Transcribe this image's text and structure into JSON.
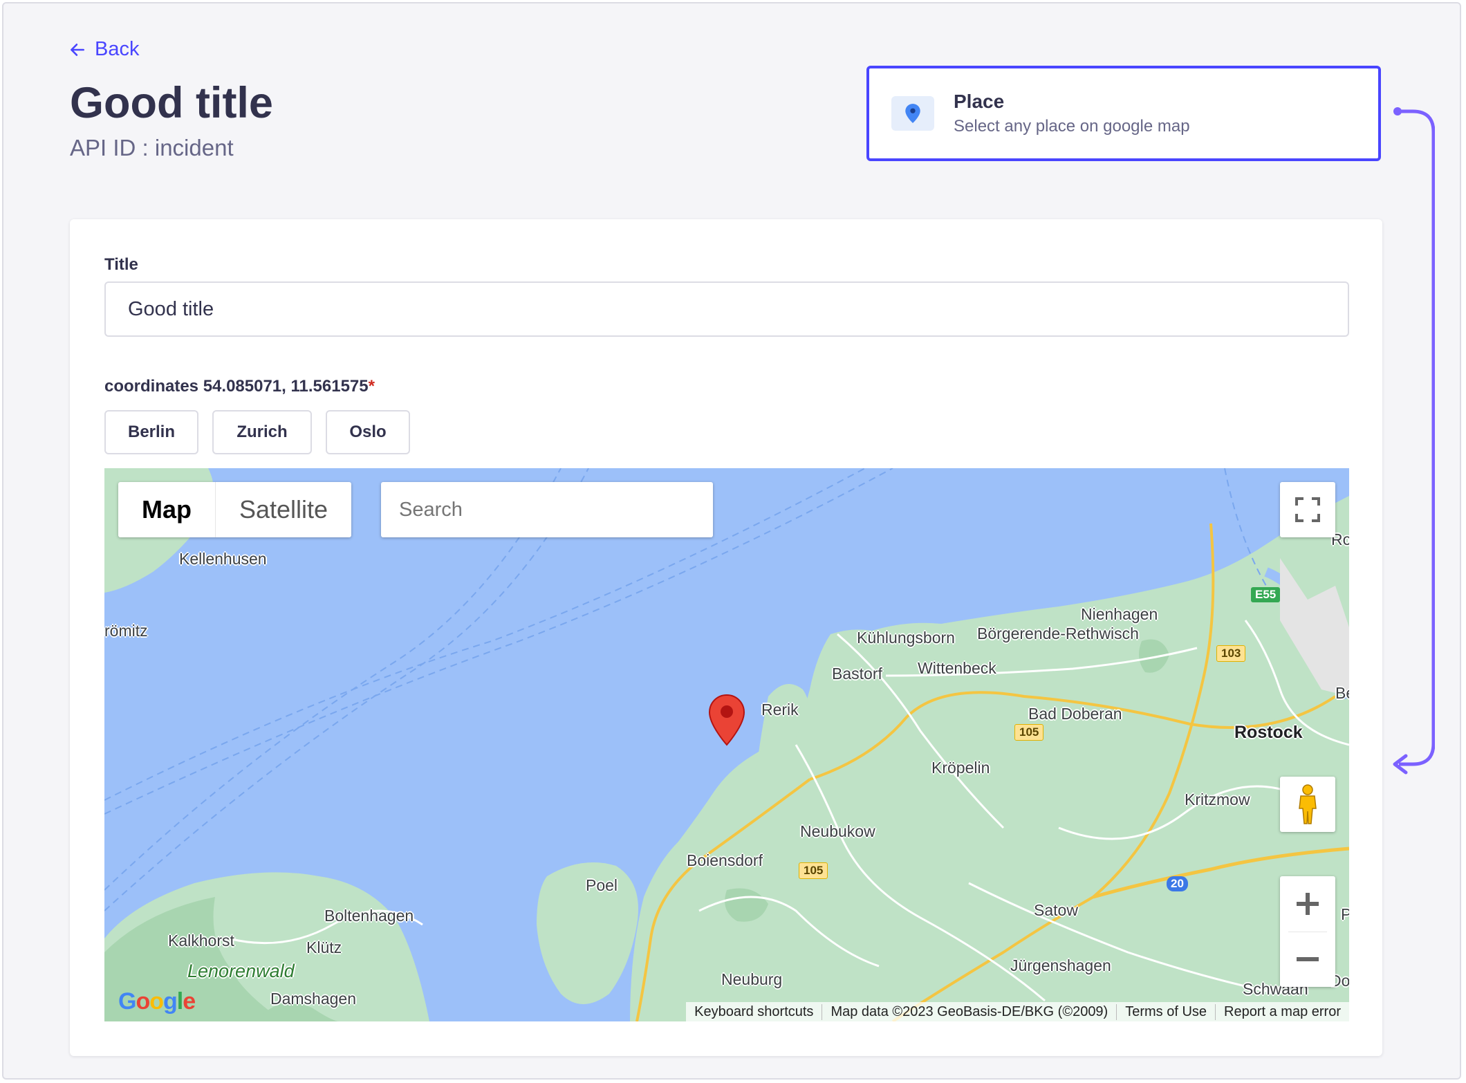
{
  "header": {
    "back_label": "Back",
    "title": "Good title",
    "api_id": "API ID : incident"
  },
  "place_card": {
    "name": "Place",
    "description": "Select any place on google map",
    "icon": "map-pin-icon"
  },
  "form": {
    "title_label": "Title",
    "title_value": "Good title",
    "coordinates_label": "coordinates 54.085071, 11.561575",
    "required_mark": "*",
    "city_buttons": [
      "Berlin",
      "Zurich",
      "Oslo"
    ]
  },
  "map": {
    "type_options": [
      "Map",
      "Satellite"
    ],
    "selected_type": "Map",
    "search_placeholder": "Search",
    "logo": "Google",
    "labels": {
      "kellenhusen": "Kellenhusen",
      "gromitz": "römitz",
      "kuhlungsborn": "Kühlungsborn",
      "nienhagen": "Nienhagen",
      "borgerende": "Börgerende-Rethwisch",
      "bastorf": "Bastorf",
      "wittenbeck": "Wittenbeck",
      "rerik": "Rerik",
      "bad_doberan": "Bad Doberan",
      "rostock": "Rostock",
      "kropelin": "Kröpelin",
      "kritzmow": "Kritzmow",
      "neubukow": "Neubukow",
      "boiensdorf": "Boiensdorf",
      "poel": "Poel",
      "satow": "Satow",
      "boltenhagen": "Boltenhagen",
      "kalkhorst": "Kalkhorst",
      "klutz": "Klütz",
      "lenorenwald": "Lenorenwald",
      "jurgenshagen": "Jürgenshagen",
      "neuburg": "Neuburg",
      "damshagen": "Damshagen",
      "schwaan": "Schwaan",
      "edge_ro": "Ro",
      "edge_be": "Be",
      "edge_p": "P",
      "edge_do": "Do"
    },
    "road_shields": {
      "e55": "E55",
      "r103": "103",
      "r105a": "105",
      "r105b": "105",
      "a20": "20"
    },
    "attribution": {
      "shortcuts": "Keyboard shortcuts",
      "data": "Map data ©2023 GeoBasis-DE/BKG (©2009)",
      "terms": "Terms of Use",
      "report": "Report a map error"
    },
    "colors": {
      "water": "#9cc0f9",
      "land": "#bfe2c6",
      "marker": "#ea4335",
      "accent": "#4945ff"
    }
  }
}
